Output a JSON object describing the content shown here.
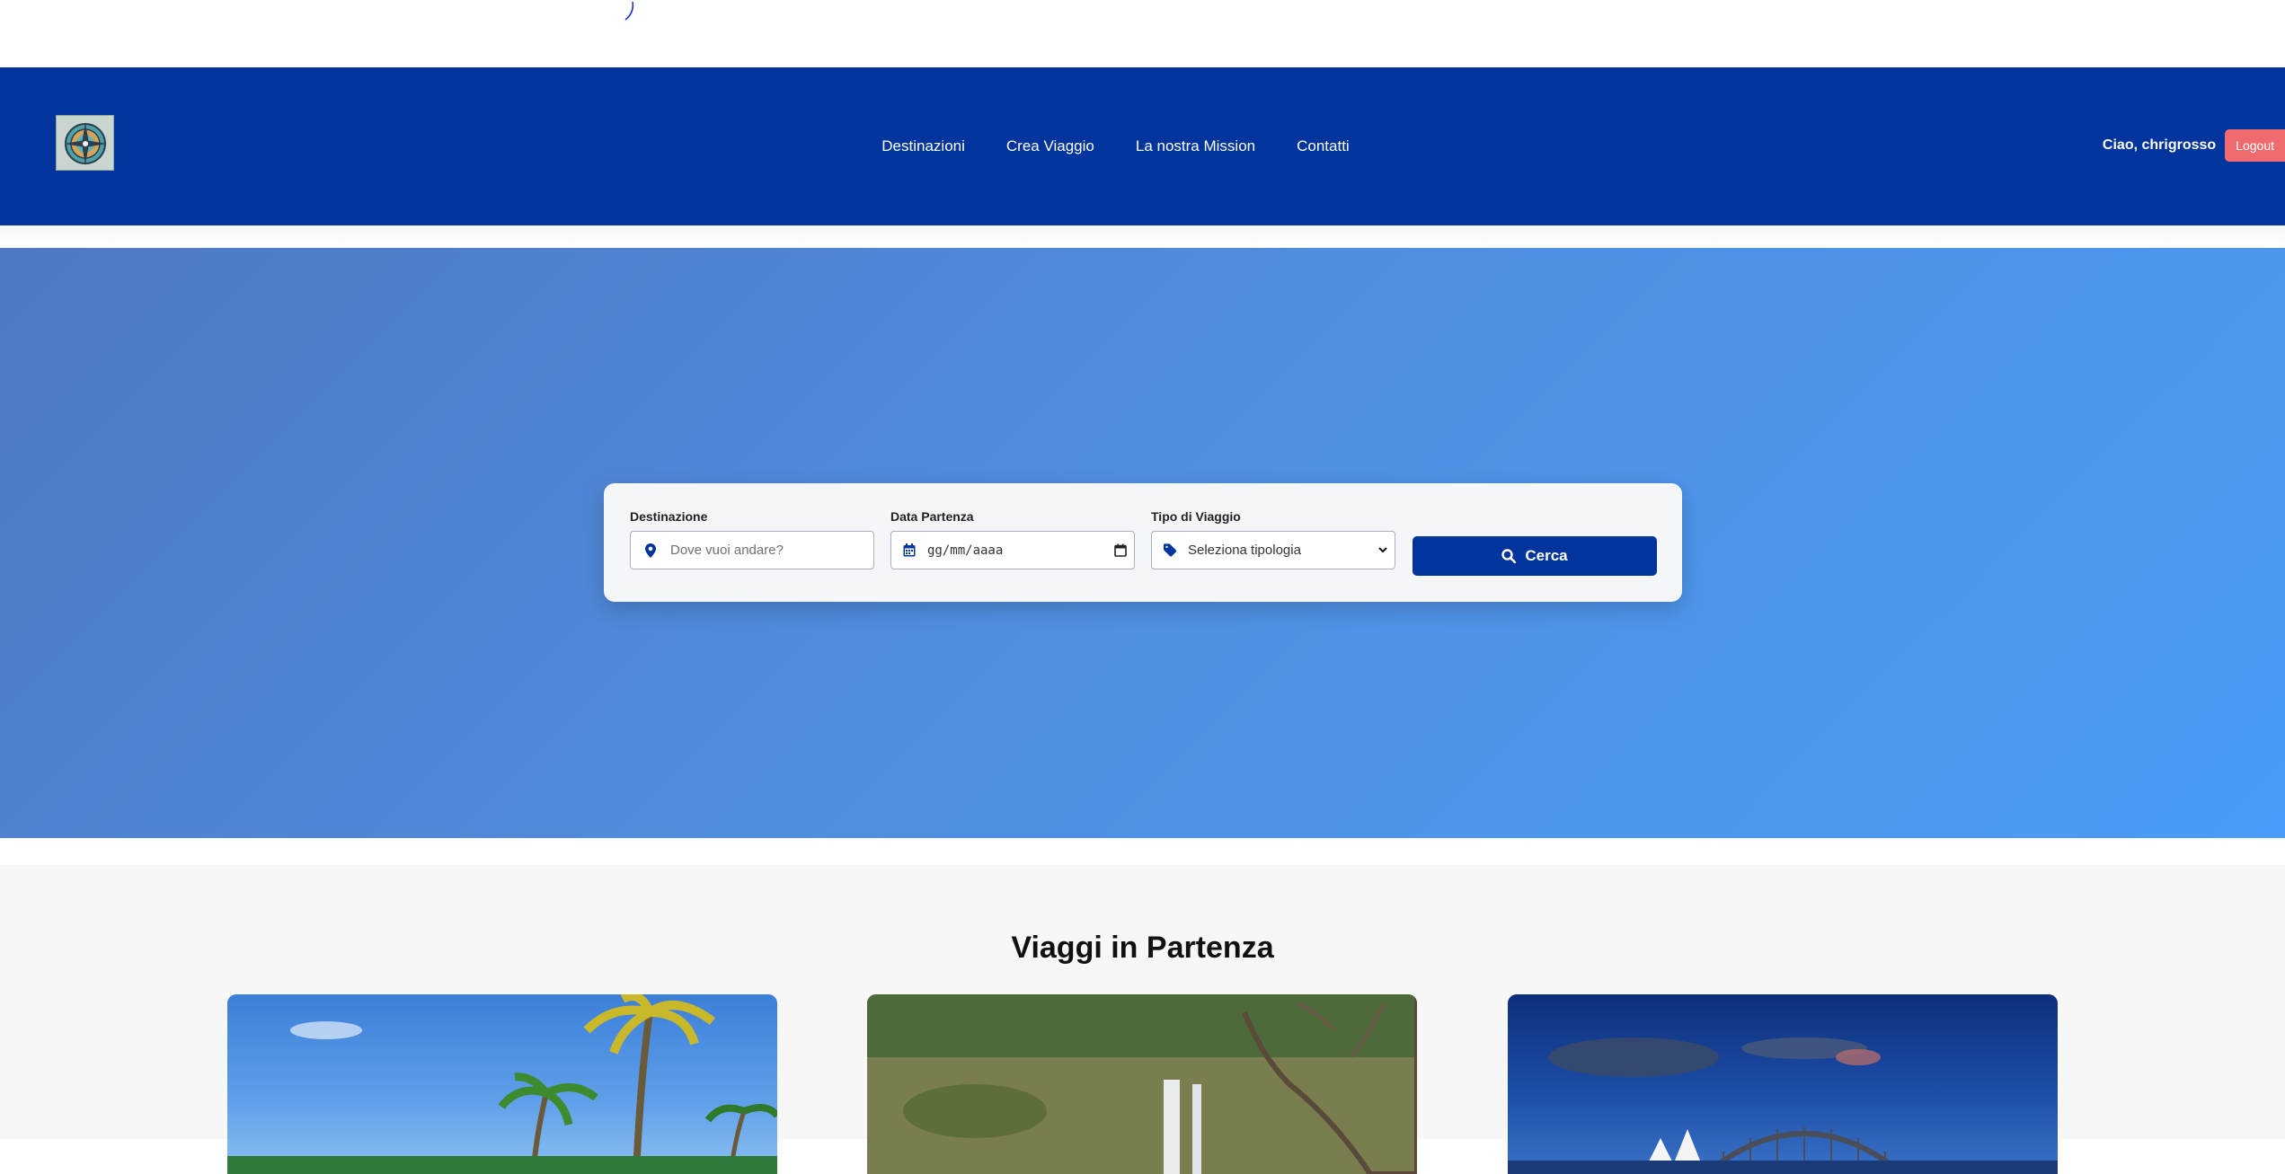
{
  "header": {
    "logo_alt": "compass-logo",
    "nav": [
      {
        "label": "Destinazioni"
      },
      {
        "label": "Crea Viaggio"
      },
      {
        "label": "La nostra Mission"
      },
      {
        "label": "Contatti"
      }
    ],
    "greeting": "Ciao, chrigrosso",
    "logout_label": "Logout"
  },
  "search": {
    "destination": {
      "label": "Destinazione",
      "placeholder": "Dove vuoi andare?",
      "icon": "map-marker-icon"
    },
    "date": {
      "label": "Data Partenza",
      "value": "gg/mm/aaaa",
      "icon": "calendar-icon"
    },
    "type": {
      "label": "Tipo di Viaggio",
      "selected": "Seleziona tipologia",
      "icon": "tag-icon"
    },
    "button_label": "Cerca",
    "button_icon": "search-icon"
  },
  "section": {
    "title": "Viaggi in Partenza",
    "cards": [
      {
        "image": "tropical-beach-palms"
      },
      {
        "image": "waterfall-jungle"
      },
      {
        "image": "sydney-opera-house"
      }
    ]
  },
  "colors": {
    "navbar": "#01349c",
    "hero_start": "#4f78c3",
    "hero_end": "#4a9cf8",
    "logout": "#f06b6f",
    "primary_button": "#01349c"
  }
}
